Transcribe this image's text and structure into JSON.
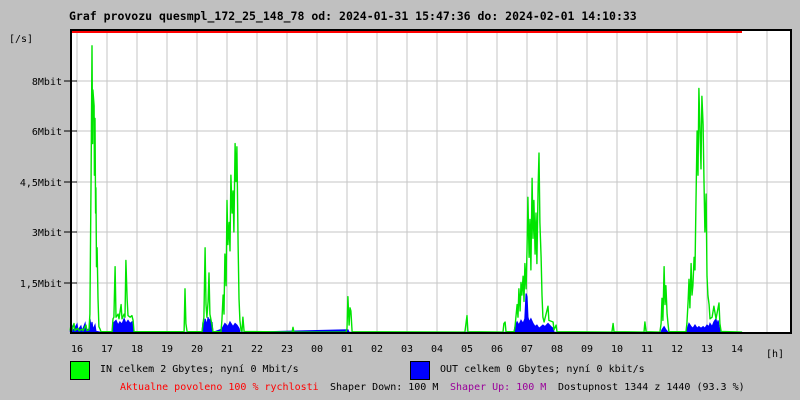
{
  "title": "Graf provozu quesmpl_172_25_148_78 od: 2024-01-31 15:47:36 do: 2024-02-01 14:10:33",
  "colors": {
    "page_background": "#c0c0c0",
    "plot_background": "#ffffff",
    "grid": "#c6c6c6",
    "frame": "#000000",
    "in_line": "#00e400",
    "in_swatch": "#00ff00",
    "out_line": "#0000ff",
    "out_swatch": "#0000ff",
    "limit_line": "#ff0000",
    "allowed_text": "#ff0000",
    "shaper_up_text": "#990099"
  },
  "legend": {
    "in_label": "IN celkem 2 Gbytes; nyní 0 Mbit/s",
    "out_label": "OUT celkem 0 Gbytes; nyní 0 kbit/s"
  },
  "footer": {
    "allowed": "Aktualne povoleno 100 % rychlosti",
    "shaper_down": "Shaper Down: 100 M",
    "shaper_up": "Shaper Up: 100 M",
    "availability": "Dostupnost 1344 z 1440 (93.3 %)"
  },
  "chart_data": {
    "type": "line",
    "title": "Graf provozu quesmpl_172_25_148_78 od: 2024-01-31 15:47:36 do: 2024-02-01 14:10:33",
    "ylabel": "[/s]",
    "xlabel": "[h]",
    "grid": true,
    "x_tick_labels": [
      "16",
      "17",
      "18",
      "19",
      "20",
      "21",
      "22",
      "23",
      "00",
      "01",
      "02",
      "03",
      "04",
      "05",
      "06",
      "07",
      "08",
      "09",
      "10",
      "11",
      "12",
      "13",
      "14"
    ],
    "y_tick_labels": [
      "1,5Mbit",
      "3Mbit",
      "4,5Mbit",
      "6Mbit",
      "8Mbit"
    ],
    "y_tick_values_mbit": [
      1.6,
      3.2,
      4.8,
      6.4,
      8.0
    ],
    "ylim_mbit": [
      0,
      9.6
    ],
    "x_start_hour": 15.77,
    "x_end_hour": 38.17,
    "limit_line": {
      "meaning": "Aktualne povoleno 100 % rychlosti",
      "drawn_at": "top_of_scale"
    },
    "series": [
      {
        "name": "IN",
        "unit": "Mbit/s",
        "points": [
          [
            15.77,
            0.08
          ],
          [
            15.8,
            0.25
          ],
          [
            15.83,
            0.08
          ],
          [
            15.9,
            0.3
          ],
          [
            15.93,
            0.08
          ],
          [
            16.03,
            0.15
          ],
          [
            16.07,
            0.07
          ],
          [
            16.17,
            0.12
          ],
          [
            16.2,
            0.07
          ],
          [
            16.3,
            0.25
          ],
          [
            16.33,
            0.08
          ],
          [
            16.4,
            0.1
          ],
          [
            16.43,
            0.6
          ],
          [
            16.47,
            5.0
          ],
          [
            16.5,
            9.1
          ],
          [
            16.52,
            6.0
          ],
          [
            16.53,
            7.7
          ],
          [
            16.57,
            7.2
          ],
          [
            16.58,
            5.0
          ],
          [
            16.6,
            6.8
          ],
          [
            16.62,
            3.8
          ],
          [
            16.63,
            4.6
          ],
          [
            16.65,
            2.1
          ],
          [
            16.67,
            2.7
          ],
          [
            16.7,
            1.1
          ],
          [
            16.73,
            0.2
          ],
          [
            16.77,
            0.12
          ],
          [
            16.8,
            0.04
          ],
          [
            17.17,
            0.04
          ],
          [
            17.2,
            0.45
          ],
          [
            17.23,
            0.5
          ],
          [
            17.27,
            2.1
          ],
          [
            17.3,
            0.5
          ],
          [
            17.37,
            0.6
          ],
          [
            17.4,
            0.45
          ],
          [
            17.47,
            0.9
          ],
          [
            17.5,
            0.45
          ],
          [
            17.57,
            0.6
          ],
          [
            17.6,
            0.5
          ],
          [
            17.63,
            2.3
          ],
          [
            17.67,
            1.1
          ],
          [
            17.7,
            0.55
          ],
          [
            17.77,
            0.5
          ],
          [
            17.83,
            0.55
          ],
          [
            17.87,
            0.4
          ],
          [
            17.9,
            0.04
          ],
          [
            19.57,
            0.04
          ],
          [
            19.6,
            1.4
          ],
          [
            19.63,
            0.3
          ],
          [
            19.67,
            0.04
          ],
          [
            20.17,
            0.04
          ],
          [
            20.2,
            0.3
          ],
          [
            20.23,
            0.5
          ],
          [
            20.27,
            2.7
          ],
          [
            20.3,
            0.9
          ],
          [
            20.33,
            0.5
          ],
          [
            20.37,
            1.0
          ],
          [
            20.4,
            1.9
          ],
          [
            20.43,
            0.6
          ],
          [
            20.47,
            0.4
          ],
          [
            20.5,
            0.25
          ],
          [
            20.53,
            0.04
          ],
          [
            20.8,
            0.04
          ],
          [
            20.83,
            0.4
          ],
          [
            20.87,
            1.2
          ],
          [
            20.9,
            0.6
          ],
          [
            20.93,
            2.5
          ],
          [
            20.97,
            1.5
          ],
          [
            21.0,
            4.2
          ],
          [
            21.03,
            2.8
          ],
          [
            21.07,
            3.5
          ],
          [
            21.1,
            2.6
          ],
          [
            21.13,
            5.0
          ],
          [
            21.17,
            3.8
          ],
          [
            21.2,
            4.5
          ],
          [
            21.23,
            3.2
          ],
          [
            21.27,
            6.0
          ],
          [
            21.3,
            4.8
          ],
          [
            21.33,
            5.9
          ],
          [
            21.37,
            2.8
          ],
          [
            21.4,
            1.1
          ],
          [
            21.43,
            0.4
          ],
          [
            21.47,
            0.08
          ],
          [
            21.5,
            0.05
          ],
          [
            21.53,
            0.5
          ],
          [
            21.57,
            0.05
          ],
          [
            23.17,
            0.03
          ],
          [
            23.2,
            0.18
          ],
          [
            23.23,
            0.03
          ],
          [
            24.97,
            0.03
          ],
          [
            25.0,
            0.15
          ],
          [
            25.03,
            1.15
          ],
          [
            25.07,
            0.25
          ],
          [
            25.1,
            0.8
          ],
          [
            25.13,
            0.7
          ],
          [
            25.17,
            0.04
          ],
          [
            28.93,
            0.03
          ],
          [
            29.0,
            0.55
          ],
          [
            29.03,
            0.04
          ],
          [
            30.2,
            0.03
          ],
          [
            30.23,
            0.3
          ],
          [
            30.27,
            0.35
          ],
          [
            30.3,
            0.04
          ],
          [
            30.57,
            0.04
          ],
          [
            30.6,
            0.2
          ],
          [
            30.67,
            0.9
          ],
          [
            30.7,
            0.5
          ],
          [
            30.73,
            1.4
          ],
          [
            30.77,
            0.7
          ],
          [
            30.8,
            1.6
          ],
          [
            30.83,
            1.2
          ],
          [
            30.87,
            1.8
          ],
          [
            30.9,
            1.0
          ],
          [
            30.93,
            2.2
          ],
          [
            30.97,
            1.4
          ],
          [
            31.0,
            2.6
          ],
          [
            31.03,
            4.3
          ],
          [
            31.07,
            2.4
          ],
          [
            31.1,
            3.6
          ],
          [
            31.13,
            2.0
          ],
          [
            31.17,
            4.9
          ],
          [
            31.2,
            3.0
          ],
          [
            31.23,
            4.2
          ],
          [
            31.27,
            2.5
          ],
          [
            31.3,
            3.8
          ],
          [
            31.33,
            2.2
          ],
          [
            31.37,
            4.6
          ],
          [
            31.4,
            5.7
          ],
          [
            31.43,
            3.5
          ],
          [
            31.47,
            2.4
          ],
          [
            31.5,
            1.2
          ],
          [
            31.53,
            0.5
          ],
          [
            31.57,
            0.35
          ],
          [
            31.7,
            0.85
          ],
          [
            31.73,
            0.4
          ],
          [
            31.87,
            0.35
          ],
          [
            31.9,
            0.1
          ],
          [
            31.97,
            0.25
          ],
          [
            32.0,
            0.04
          ],
          [
            33.83,
            0.03
          ],
          [
            33.87,
            0.3
          ],
          [
            33.9,
            0.04
          ],
          [
            34.9,
            0.03
          ],
          [
            34.93,
            0.35
          ],
          [
            34.97,
            0.04
          ],
          [
            35.43,
            0.03
          ],
          [
            35.47,
            0.3
          ],
          [
            35.5,
            1.1
          ],
          [
            35.53,
            0.4
          ],
          [
            35.57,
            2.1
          ],
          [
            35.6,
            0.9
          ],
          [
            35.63,
            1.5
          ],
          [
            35.67,
            0.6
          ],
          [
            35.7,
            0.3
          ],
          [
            35.73,
            0.04
          ],
          [
            36.3,
            0.04
          ],
          [
            36.33,
            0.3
          ],
          [
            36.37,
            1.0
          ],
          [
            36.4,
            1.7
          ],
          [
            36.43,
            0.8
          ],
          [
            36.47,
            2.2
          ],
          [
            36.5,
            1.2
          ],
          [
            36.53,
            1.5
          ],
          [
            36.57,
            2.4
          ],
          [
            36.6,
            2.0
          ],
          [
            36.63,
            4.0
          ],
          [
            36.67,
            6.4
          ],
          [
            36.7,
            5.0
          ],
          [
            36.73,
            7.75
          ],
          [
            36.77,
            6.3
          ],
          [
            36.8,
            5.2
          ],
          [
            36.83,
            7.5
          ],
          [
            36.87,
            6.6
          ],
          [
            36.9,
            4.8
          ],
          [
            36.93,
            3.2
          ],
          [
            36.97,
            4.4
          ],
          [
            37.0,
            1.8
          ],
          [
            37.03,
            1.2
          ],
          [
            37.07,
            0.9
          ],
          [
            37.1,
            0.45
          ],
          [
            37.17,
            0.5
          ],
          [
            37.23,
            0.85
          ],
          [
            37.3,
            0.45
          ],
          [
            37.4,
            0.95
          ],
          [
            37.43,
            0.3
          ],
          [
            37.47,
            0.05
          ],
          [
            38.17,
            0.03
          ]
        ]
      },
      {
        "name": "OUT",
        "unit": "Mbit/s",
        "points": [
          [
            15.77,
            0.04
          ],
          [
            15.83,
            0.22
          ],
          [
            15.87,
            0.06
          ],
          [
            16.0,
            0.28
          ],
          [
            16.03,
            0.08
          ],
          [
            16.13,
            0.22
          ],
          [
            16.17,
            0.06
          ],
          [
            16.27,
            0.3
          ],
          [
            16.3,
            0.1
          ],
          [
            16.4,
            0.12
          ],
          [
            16.43,
            0.45
          ],
          [
            16.47,
            0.15
          ],
          [
            16.5,
            0.35
          ],
          [
            16.53,
            0.1
          ],
          [
            16.6,
            0.25
          ],
          [
            16.63,
            0.05
          ],
          [
            16.8,
            0.02
          ],
          [
            17.17,
            0.02
          ],
          [
            17.2,
            0.3
          ],
          [
            17.3,
            0.4
          ],
          [
            17.37,
            0.25
          ],
          [
            17.43,
            0.35
          ],
          [
            17.5,
            0.28
          ],
          [
            17.57,
            0.45
          ],
          [
            17.63,
            0.3
          ],
          [
            17.7,
            0.4
          ],
          [
            17.77,
            0.3
          ],
          [
            17.83,
            0.35
          ],
          [
            17.9,
            0.02
          ],
          [
            20.17,
            0.02
          ],
          [
            20.2,
            0.35
          ],
          [
            20.23,
            0.2
          ],
          [
            20.27,
            0.45
          ],
          [
            20.33,
            0.25
          ],
          [
            20.37,
            0.5
          ],
          [
            20.4,
            0.3
          ],
          [
            20.43,
            0.45
          ],
          [
            20.47,
            0.2
          ],
          [
            20.5,
            0.35
          ],
          [
            20.53,
            0.02
          ],
          [
            20.83,
            0.12
          ],
          [
            20.93,
            0.3
          ],
          [
            21.03,
            0.2
          ],
          [
            21.1,
            0.35
          ],
          [
            21.2,
            0.2
          ],
          [
            21.27,
            0.3
          ],
          [
            21.33,
            0.25
          ],
          [
            21.4,
            0.15
          ],
          [
            21.43,
            0.02
          ],
          [
            25.03,
            0.1
          ],
          [
            25.07,
            0.02
          ],
          [
            30.57,
            0.02
          ],
          [
            30.6,
            0.2
          ],
          [
            30.67,
            0.35
          ],
          [
            30.73,
            0.25
          ],
          [
            30.8,
            0.4
          ],
          [
            30.87,
            0.3
          ],
          [
            30.93,
            0.45
          ],
          [
            30.97,
            1.25
          ],
          [
            31.0,
            1.15
          ],
          [
            31.03,
            0.5
          ],
          [
            31.07,
            0.35
          ],
          [
            31.13,
            0.45
          ],
          [
            31.2,
            0.3
          ],
          [
            31.27,
            0.2
          ],
          [
            31.33,
            0.25
          ],
          [
            31.4,
            0.15
          ],
          [
            31.47,
            0.2
          ],
          [
            31.53,
            0.25
          ],
          [
            31.6,
            0.2
          ],
          [
            31.7,
            0.3
          ],
          [
            31.8,
            0.2
          ],
          [
            31.87,
            0.15
          ],
          [
            31.9,
            0.02
          ],
          [
            35.47,
            0.02
          ],
          [
            35.5,
            0.1
          ],
          [
            35.57,
            0.2
          ],
          [
            35.63,
            0.1
          ],
          [
            35.7,
            0.02
          ],
          [
            36.3,
            0.02
          ],
          [
            36.33,
            0.1
          ],
          [
            36.4,
            0.3
          ],
          [
            36.47,
            0.2
          ],
          [
            36.53,
            0.15
          ],
          [
            36.6,
            0.25
          ],
          [
            36.67,
            0.15
          ],
          [
            36.73,
            0.2
          ],
          [
            36.8,
            0.15
          ],
          [
            36.87,
            0.2
          ],
          [
            36.93,
            0.15
          ],
          [
            37.0,
            0.25
          ],
          [
            37.07,
            0.2
          ],
          [
            37.1,
            0.3
          ],
          [
            37.17,
            0.2
          ],
          [
            37.23,
            0.35
          ],
          [
            37.3,
            0.45
          ],
          [
            37.33,
            0.25
          ],
          [
            37.37,
            0.4
          ],
          [
            37.4,
            0.2
          ],
          [
            37.43,
            0.12
          ],
          [
            37.47,
            0.02
          ],
          [
            38.17,
            0.02
          ]
        ]
      }
    ]
  }
}
